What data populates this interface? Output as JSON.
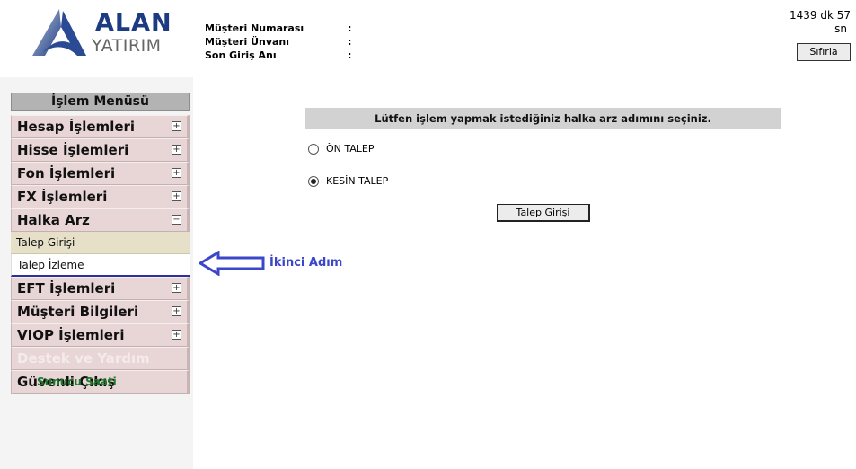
{
  "header": {
    "logo_line1": "ALAN",
    "logo_line2": "YATIRIM",
    "customer_fields": [
      {
        "label": "Müşteri Numarası",
        "value": ":"
      },
      {
        "label": "Müşteri Ünvanı",
        "value": ":"
      },
      {
        "label": "Son Giriş Anı",
        "value": ":"
      }
    ],
    "timer_line1": "1439 dk 57",
    "timer_line2": "sn",
    "reset_label": "Sıfırla"
  },
  "menu": {
    "title": "İşlem Menüsü",
    "items": [
      {
        "label": "Hesap İşlemleri",
        "toggle": "+"
      },
      {
        "label": "Hisse İşlemleri",
        "toggle": "+"
      },
      {
        "label": "Fon İşlemleri",
        "toggle": "+"
      },
      {
        "label": "FX İşlemleri",
        "toggle": "+"
      },
      {
        "label": "Halka Arz",
        "toggle": "−"
      }
    ],
    "subitems": [
      {
        "label": "Talep Girişi"
      },
      {
        "label": "Talep İzleme"
      }
    ],
    "items_after": [
      {
        "label": "EFT İşlemleri",
        "toggle": "+"
      },
      {
        "label": "Müşteri Bilgileri",
        "toggle": "+"
      },
      {
        "label": "VIOP İşlemleri",
        "toggle": "+"
      },
      {
        "label": "Destek ve Yardım"
      },
      {
        "label": "Güvenli Çıkış"
      }
    ]
  },
  "server_time_label": "Sunucu Saati",
  "main": {
    "instruction": "Lütfen işlem yapmak istediğiniz halka arz adımını seçiniz.",
    "options": [
      {
        "label": "ÖN TALEP",
        "selected": false
      },
      {
        "label": "KESİN TALEP",
        "selected": true
      }
    ],
    "submit_label": "Talep Girişi"
  },
  "annotation": "İkinci Adım",
  "colors": {
    "brand_blue": "#1d3b82",
    "menu_bg": "#e8d6d6",
    "annotation_blue": "#3c46c8",
    "server_green": "#1d7a2b"
  }
}
